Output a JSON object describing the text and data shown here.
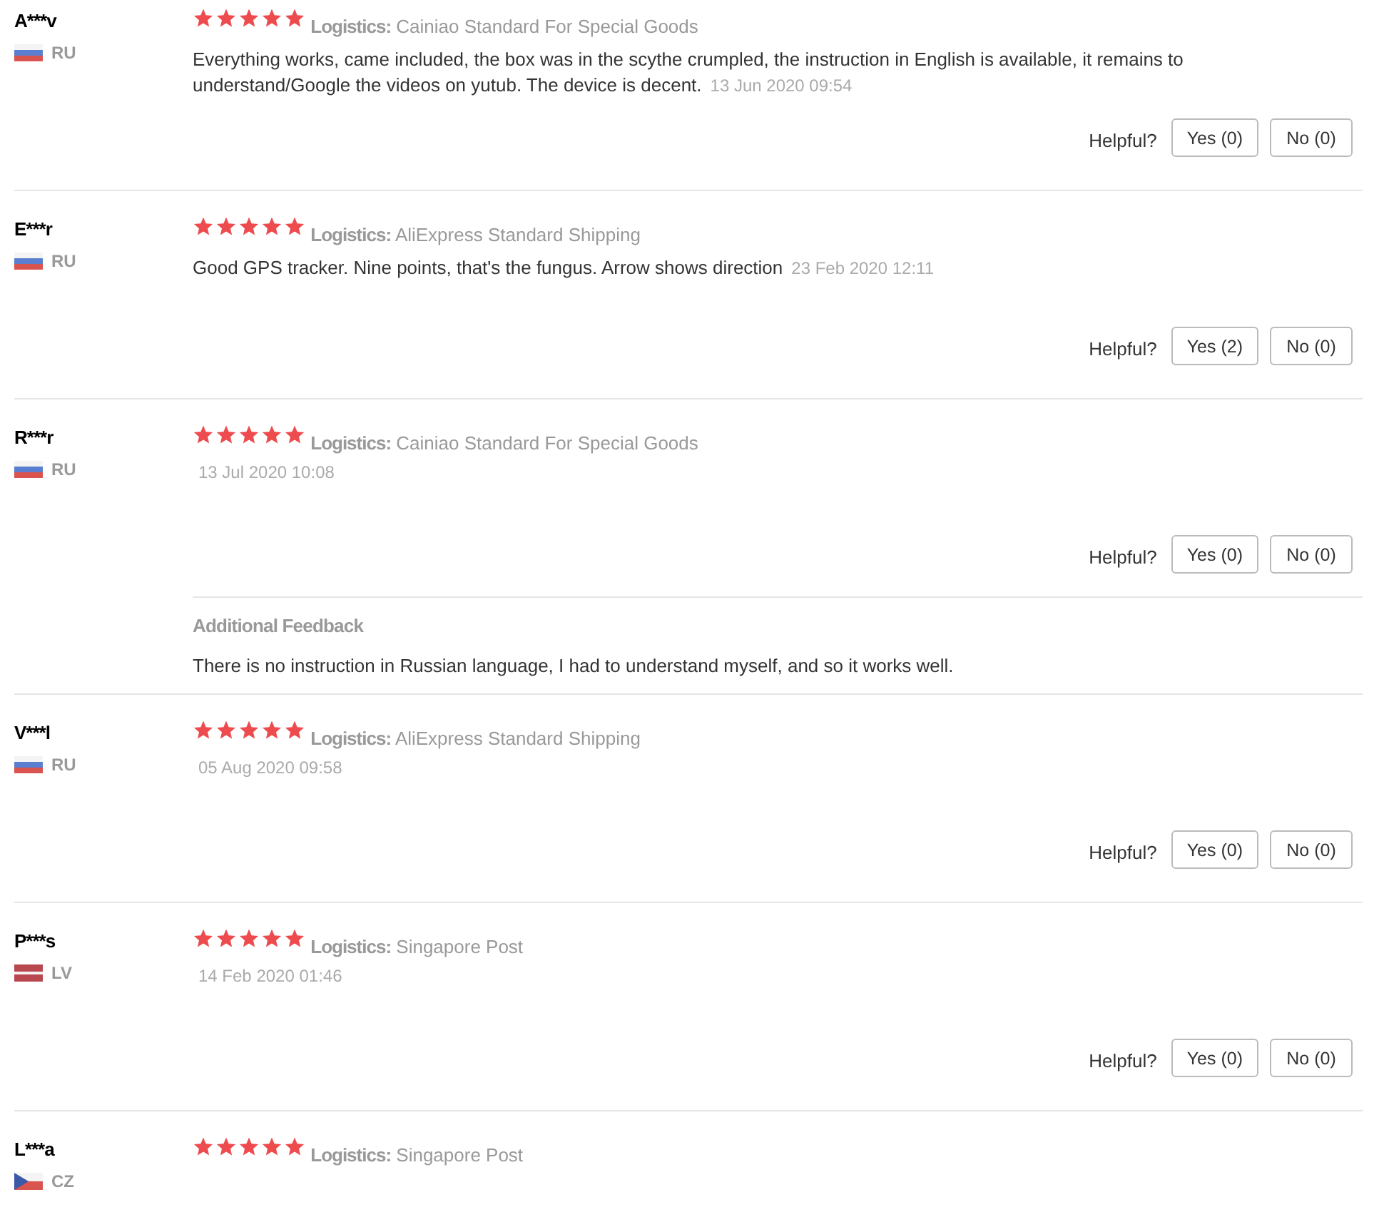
{
  "reviews": [
    {
      "name": "A***v",
      "country": "RU",
      "kind": "ru",
      "stars": 5,
      "logistics_label": "Logistics:",
      "logistics": "Cainiao Standard For Special Goods",
      "text": "Everything works, came included, the box was in the scythe crumpled, the instruction in English is available, it remains to understand/Google the videos on yutub. The device is decent.",
      "date": "13 Jun 2020 09:54",
      "helpful_label": "Helpful?",
      "yes": "Yes (0)",
      "no": "No (0)"
    },
    {
      "name": "E***r",
      "country": "RU",
      "kind": "ru",
      "stars": 5,
      "logistics_label": "Logistics:",
      "logistics": "AliExpress Standard Shipping",
      "text": "Good GPS tracker. Nine points, that's the fungus. Arrow shows direction",
      "date": "23 Feb 2020 12:11",
      "helpful_label": "Helpful?",
      "yes": "Yes (2)",
      "no": "No (0)"
    },
    {
      "name": "R***r",
      "country": "RU",
      "kind": "ru",
      "stars": 5,
      "logistics_label": "Logistics:",
      "logistics": "Cainiao Standard For Special Goods",
      "date": "13 Jul 2020 10:08",
      "helpful_label": "Helpful?",
      "yes": "Yes (0)",
      "no": "No (0)",
      "additional": {
        "title": "Additional Feedback",
        "text": "There is no instruction in Russian language, I had to understand myself, and so it works well."
      }
    },
    {
      "name": "V***l",
      "country": "RU",
      "kind": "ru",
      "stars": 5,
      "logistics_label": "Logistics:",
      "logistics": "AliExpress Standard Shipping",
      "date": "05 Aug 2020 09:58",
      "helpful_label": "Helpful?",
      "yes": "Yes (0)",
      "no": "No (0)"
    },
    {
      "name": "P***s",
      "country": "LV",
      "kind": "lv",
      "stars": 5,
      "logistics_label": "Logistics:",
      "logistics": "Singapore Post",
      "date": "14 Feb 2020 01:46",
      "helpful_label": "Helpful?",
      "yes": "Yes (0)",
      "no": "No (0)"
    },
    {
      "name": "L***a",
      "country": "CZ",
      "kind": "cz",
      "stars": 5,
      "logistics_label": "Logistics:",
      "logistics": "Singapore Post"
    }
  ]
}
